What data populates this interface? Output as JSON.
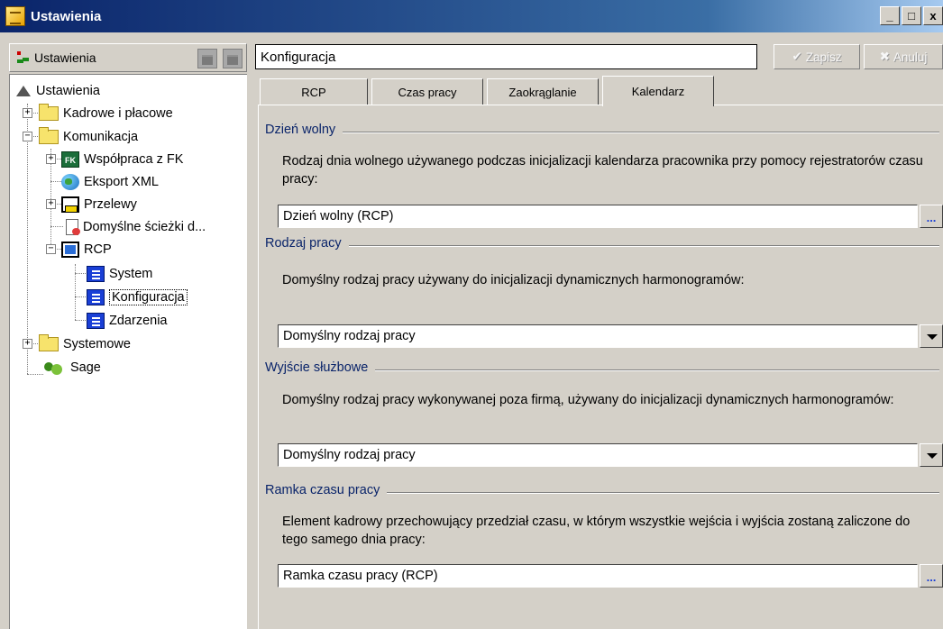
{
  "window": {
    "title": "Ustawienia",
    "controls": {
      "minimize": "_",
      "maximize": "□",
      "close": "x"
    }
  },
  "left": {
    "toolbar_label": "Ustawienia",
    "tree": {
      "root": "Ustawienia",
      "kadrowe": "Kadrowe i płacowe",
      "komunikacja": "Komunikacja",
      "wspolpraca": "Współpraca z FK",
      "eksport": "Eksport XML",
      "przelewy": "Przelewy",
      "sciezki": "Domyślne ścieżki d...",
      "rcp": "RCP",
      "system": "System",
      "konfiguracja": "Konfiguracja",
      "zdarzenia": "Zdarzenia",
      "systemowe": "Systemowe",
      "sage": "Sage",
      "fk_badge": "FK"
    }
  },
  "right": {
    "header_title": "Konfiguracja",
    "save_label": "Zapisz",
    "cancel_label": "Anuluj",
    "save_glyph": "✔",
    "cancel_glyph": "✖",
    "tabs": [
      "RCP",
      "Czas pracy",
      "Zaokrąglanie",
      "Kalendarz"
    ],
    "active_tab": "Kalendarz",
    "groups": {
      "dzien_wolny": {
        "title": "Dzień wolny",
        "description": "Rodzaj dnia wolnego używanego podczas inicjalizacji kalendarza pracownika przy pomocy rejestratorów czasu pracy:",
        "value": "Dzień wolny (RCP)",
        "button": "..."
      },
      "rodzaj_pracy": {
        "title": "Rodzaj pracy",
        "description": "Domyślny rodzaj pracy używany do inicjalizacji dynamicznych harmonogramów:",
        "value": "Domyślny rodzaj pracy"
      },
      "wyjscie_sluzbowe": {
        "title": "Wyjście służbowe",
        "description": "Domyślny rodzaj pracy wykonywanej poza firmą, używany do inicjalizacji dynamicznych harmonogramów:",
        "value": "Domyślny rodzaj pracy"
      },
      "ramka": {
        "title": "Ramka czasu pracy",
        "description": "Element kadrowy przechowujący przedział czasu, w którym wszystkie wejścia i wyjścia zostaną zaliczone do tego samego dnia pracy:",
        "value": "Ramka czasu pracy (RCP)",
        "button": "..."
      }
    }
  }
}
